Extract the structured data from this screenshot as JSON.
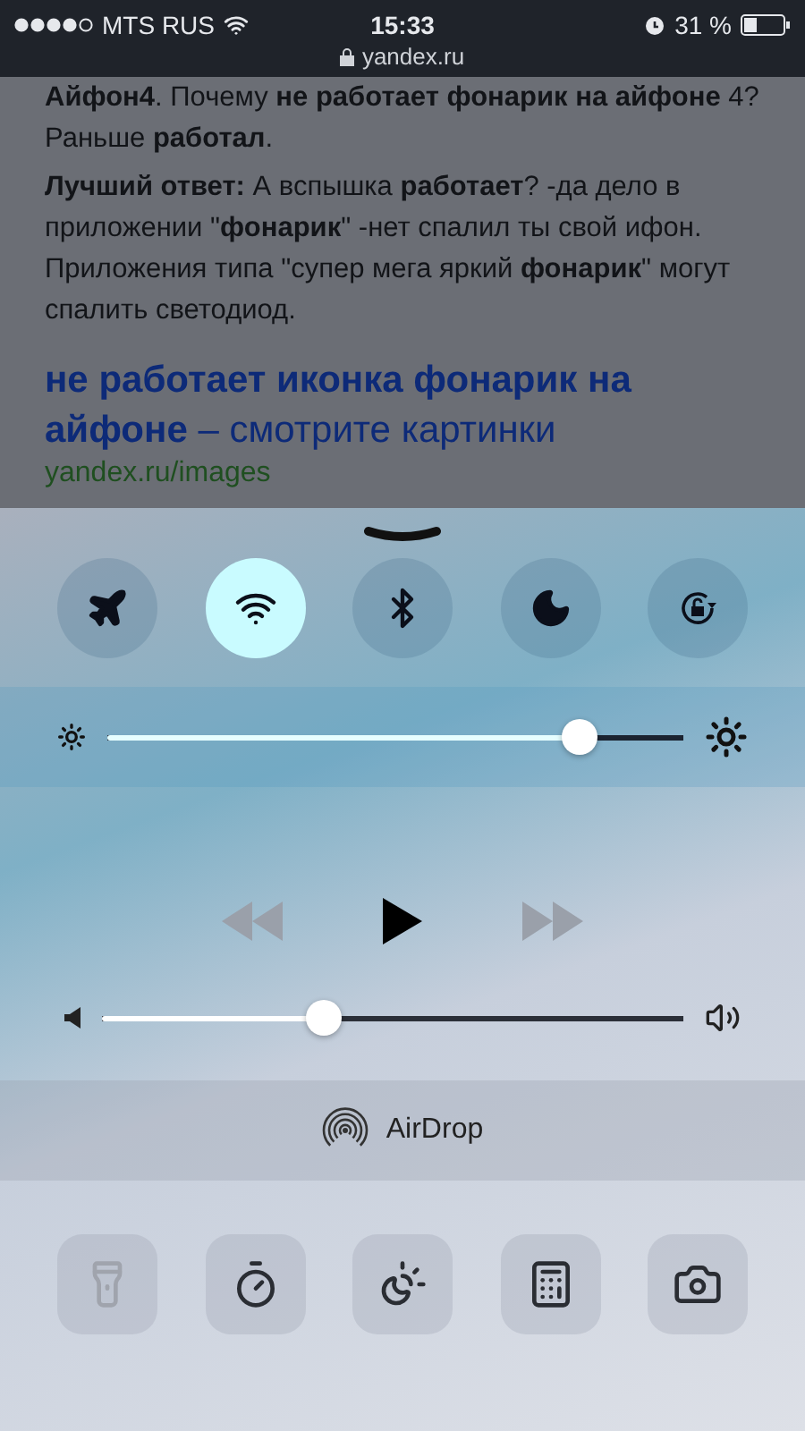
{
  "status_bar": {
    "carrier": "MTS RUS",
    "time": "15:33",
    "battery": "31 %"
  },
  "url": "yandex.ru",
  "page": {
    "paragraphs": [
      "**Айфон4**. Почему **не работает фонарик на айфоне** 4? Раньше **работал**.",
      "**Лучший ответ:** А вспышка **работает**? -да дело в приложении \"**фонарик**\" -нет спалил ты свой ифон. Приложения типа \"супер мега яркий **фонарик**\" могут спалить светодиод."
    ],
    "result_title": "**не работает иконка фонарик на айфоне** – смотрите картинки",
    "result_url": "yandex.ru/images"
  },
  "control_center": {
    "toggles": [
      {
        "kind": "airplane",
        "on": false
      },
      {
        "kind": "wifi",
        "on": true
      },
      {
        "kind": "bluetooth",
        "on": false
      },
      {
        "kind": "moon",
        "on": false
      },
      {
        "kind": "rotation-lock",
        "on": false
      }
    ],
    "brightness": {
      "level": 0.82
    },
    "media": [
      {
        "kind": "rewind",
        "disabled": true
      },
      {
        "kind": "play",
        "disabled": false
      },
      {
        "kind": "forward",
        "disabled": true
      }
    ],
    "volume": {
      "level": 0.38
    },
    "airdrop": "AirDrop",
    "shortcuts": [
      {
        "kind": "flashlight",
        "disabled": true
      },
      {
        "kind": "timer",
        "disabled": false
      },
      {
        "kind": "night-shift",
        "disabled": false
      },
      {
        "kind": "calculator",
        "disabled": false
      },
      {
        "kind": "camera",
        "disabled": false
      }
    ]
  }
}
